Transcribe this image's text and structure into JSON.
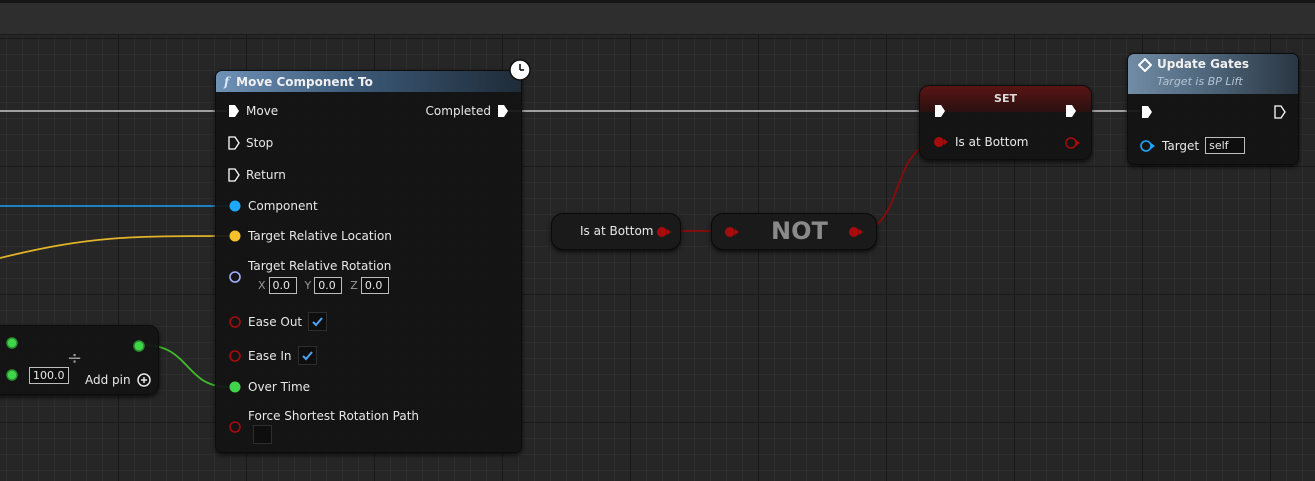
{
  "move_component_node": {
    "title": "Move Component To",
    "func_glyph": "f",
    "inputs": {
      "move": "Move",
      "stop": "Stop",
      "return": "Return",
      "component": "Component",
      "target_location": "Target Relative Location",
      "target_rotation": "Target Relative Rotation",
      "rot_x_label": "X",
      "rot_x_value": "0.0",
      "rot_y_label": "Y",
      "rot_y_value": "0.0",
      "rot_z_label": "Z",
      "rot_z_value": "0.0",
      "ease_out": "Ease Out",
      "ease_in": "Ease In",
      "over_time": "Over Time",
      "force_shortest": "Force Shortest Rotation Path"
    },
    "ease_out_checked": true,
    "ease_in_checked": true,
    "force_shortest_checked": false,
    "outputs": {
      "completed": "Completed"
    }
  },
  "divide_node": {
    "input_value": "100.0",
    "add_pin_label": "Add pin",
    "operator_glyph": "÷"
  },
  "is_at_bottom_getter": {
    "label": "Is at Bottom"
  },
  "not_node": {
    "label": "NOT"
  },
  "set_node": {
    "title": "SET",
    "pin_label": "Is at Bottom"
  },
  "update_gates_node": {
    "title": "Update Gates",
    "subtitle": "Target is BP Lift",
    "target_label": "Target",
    "target_value": "self"
  },
  "colors": {
    "exec": "#ffffff",
    "object_pin": "#1ea7ff",
    "vector_pin": "#f5c02a",
    "rotator_pin": "#9fb0ff",
    "bool_pin": "#a60c0c",
    "float_pin": "#3fd64a",
    "wire_blue": "#1e8fd6",
    "wire_yellow": "#e0b32a",
    "wire_red": "#8c0a0a",
    "wire_green": "#3fbb29"
  }
}
